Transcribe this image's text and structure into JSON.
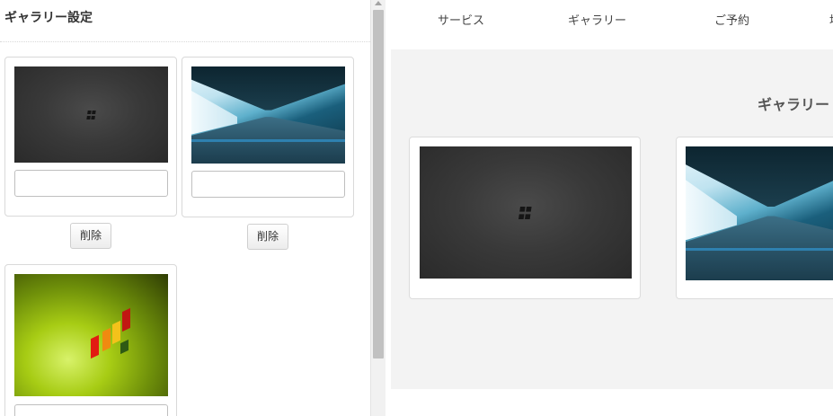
{
  "left_panel": {
    "title": "ギャラリー設定",
    "delete_label": "削除",
    "items": [
      {
        "image": "windows-dark-wallpaper",
        "caption": ""
      },
      {
        "image": "glass-corridor-photo",
        "caption": ""
      },
      {
        "image": "green-blocks-wallpaper",
        "caption": ""
      }
    ]
  },
  "preview": {
    "nav": [
      "サービス",
      "ギャラリー",
      "ご予約",
      "地"
    ],
    "gallery_heading": "ギャラリー",
    "images": [
      "windows-dark-wallpaper",
      "glass-corridor-photo"
    ]
  }
}
